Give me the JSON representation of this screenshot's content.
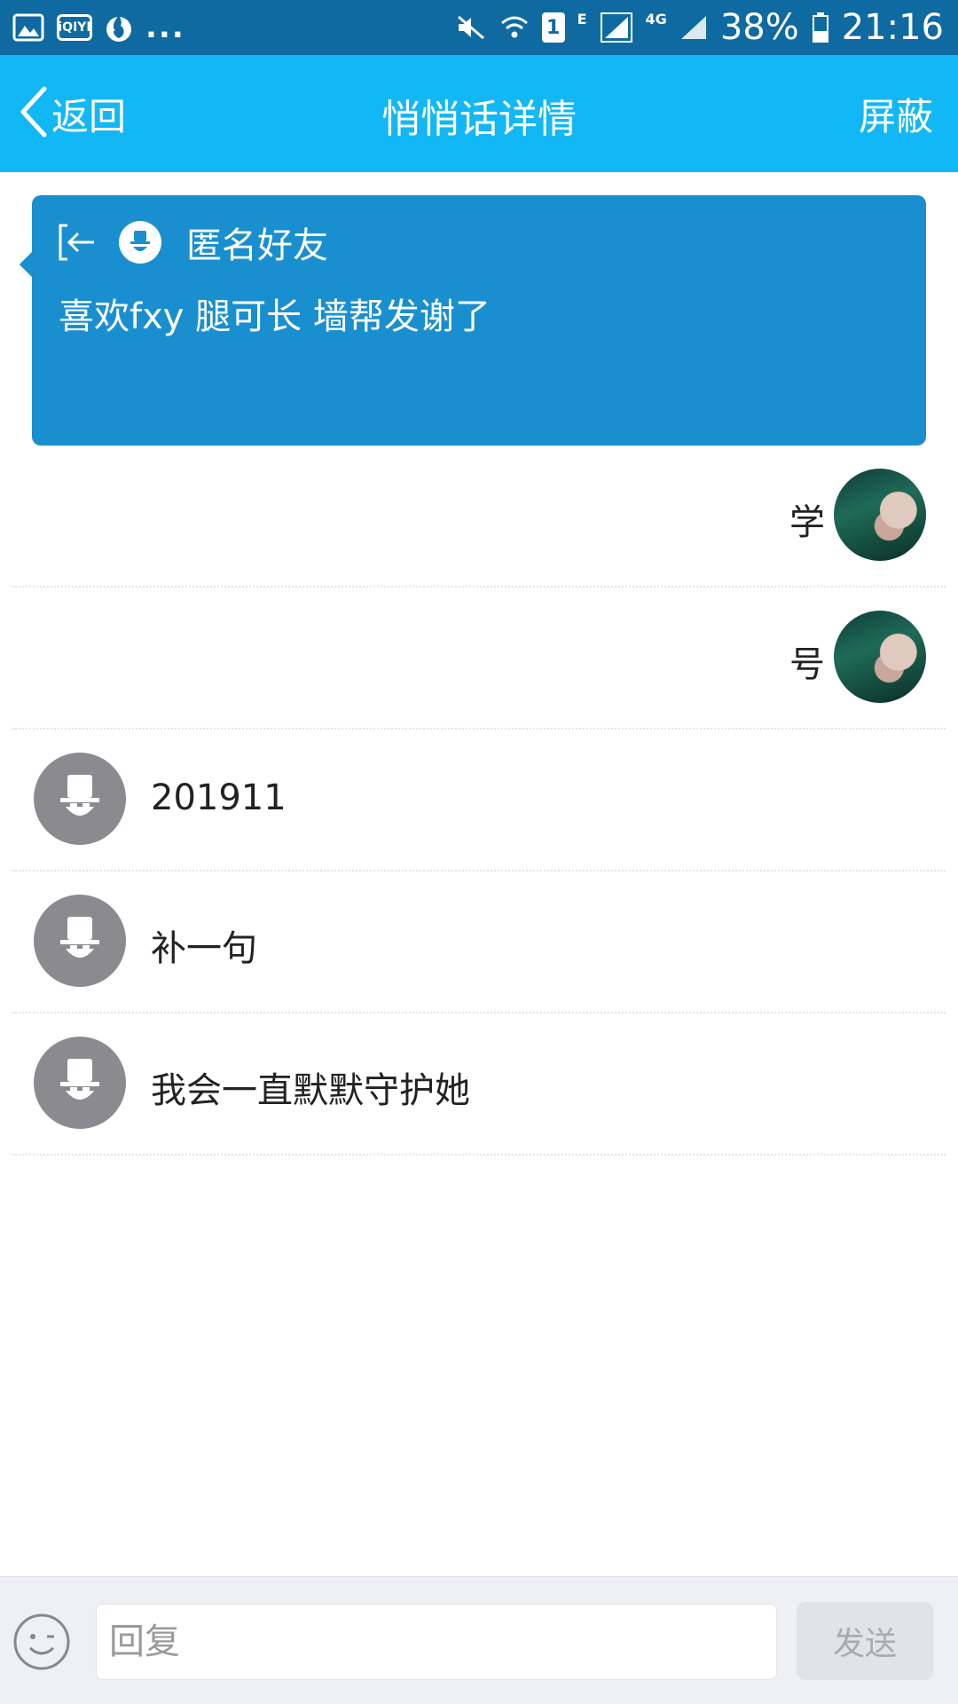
{
  "status_bar": {
    "dots": "...",
    "iqiyi_label": "iQIYI",
    "sim_slot": "1",
    "network_e": "E",
    "network_4g": "4G",
    "battery": "38%",
    "time": "21:16",
    "icons": [
      "gallery-icon",
      "iqiyi-icon",
      "flame-app-icon",
      "mute-icon",
      "wifi-icon",
      "sim-icon",
      "signal-icon",
      "battery-icon"
    ]
  },
  "header": {
    "back_label": "返回",
    "title": "悄悄话详情",
    "block_label": "屏蔽",
    "bg_color": "#12b7f5"
  },
  "card": {
    "sender": "匿名好友",
    "message": "喜欢fxy 腿可长 墙帮发谢了",
    "bg_color": "#1a8fcf"
  },
  "messages": [
    {
      "side": "right",
      "text": "学",
      "avatar": "photo"
    },
    {
      "side": "right",
      "text": "号",
      "avatar": "photo"
    },
    {
      "side": "left",
      "text": "201911",
      "avatar": "anonymous"
    },
    {
      "side": "left",
      "text": "补一句",
      "avatar": "anonymous"
    },
    {
      "side": "left",
      "text": "我会一直默默守护她",
      "avatar": "anonymous"
    }
  ],
  "composer": {
    "placeholder": "回复",
    "send_label": "发送"
  }
}
